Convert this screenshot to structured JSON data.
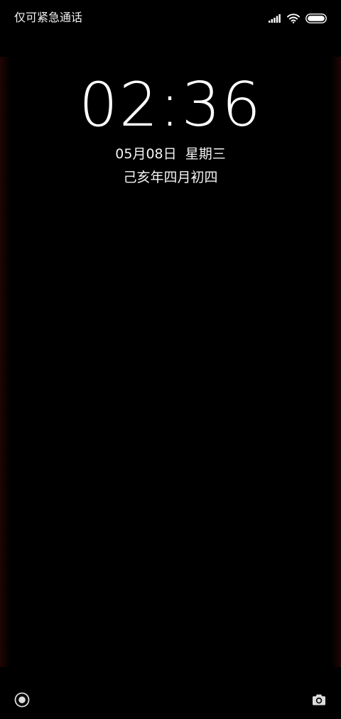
{
  "status_bar": {
    "carrier_text": "仅可紧急通话",
    "signal_icon": "signal-bars-icon",
    "wifi_icon": "wifi-icon",
    "battery_icon": "battery-icon"
  },
  "lock_screen": {
    "time": "02:36",
    "date": "05月08日",
    "weekday": "星期三",
    "lunar_date": "己亥年四月初四"
  },
  "shortcuts": {
    "left_icon": "smart-assistant-icon",
    "right_icon": "camera-icon"
  },
  "colors": {
    "background": "#000000",
    "text": "#ffffff",
    "edge_glow": "#3c0808"
  }
}
